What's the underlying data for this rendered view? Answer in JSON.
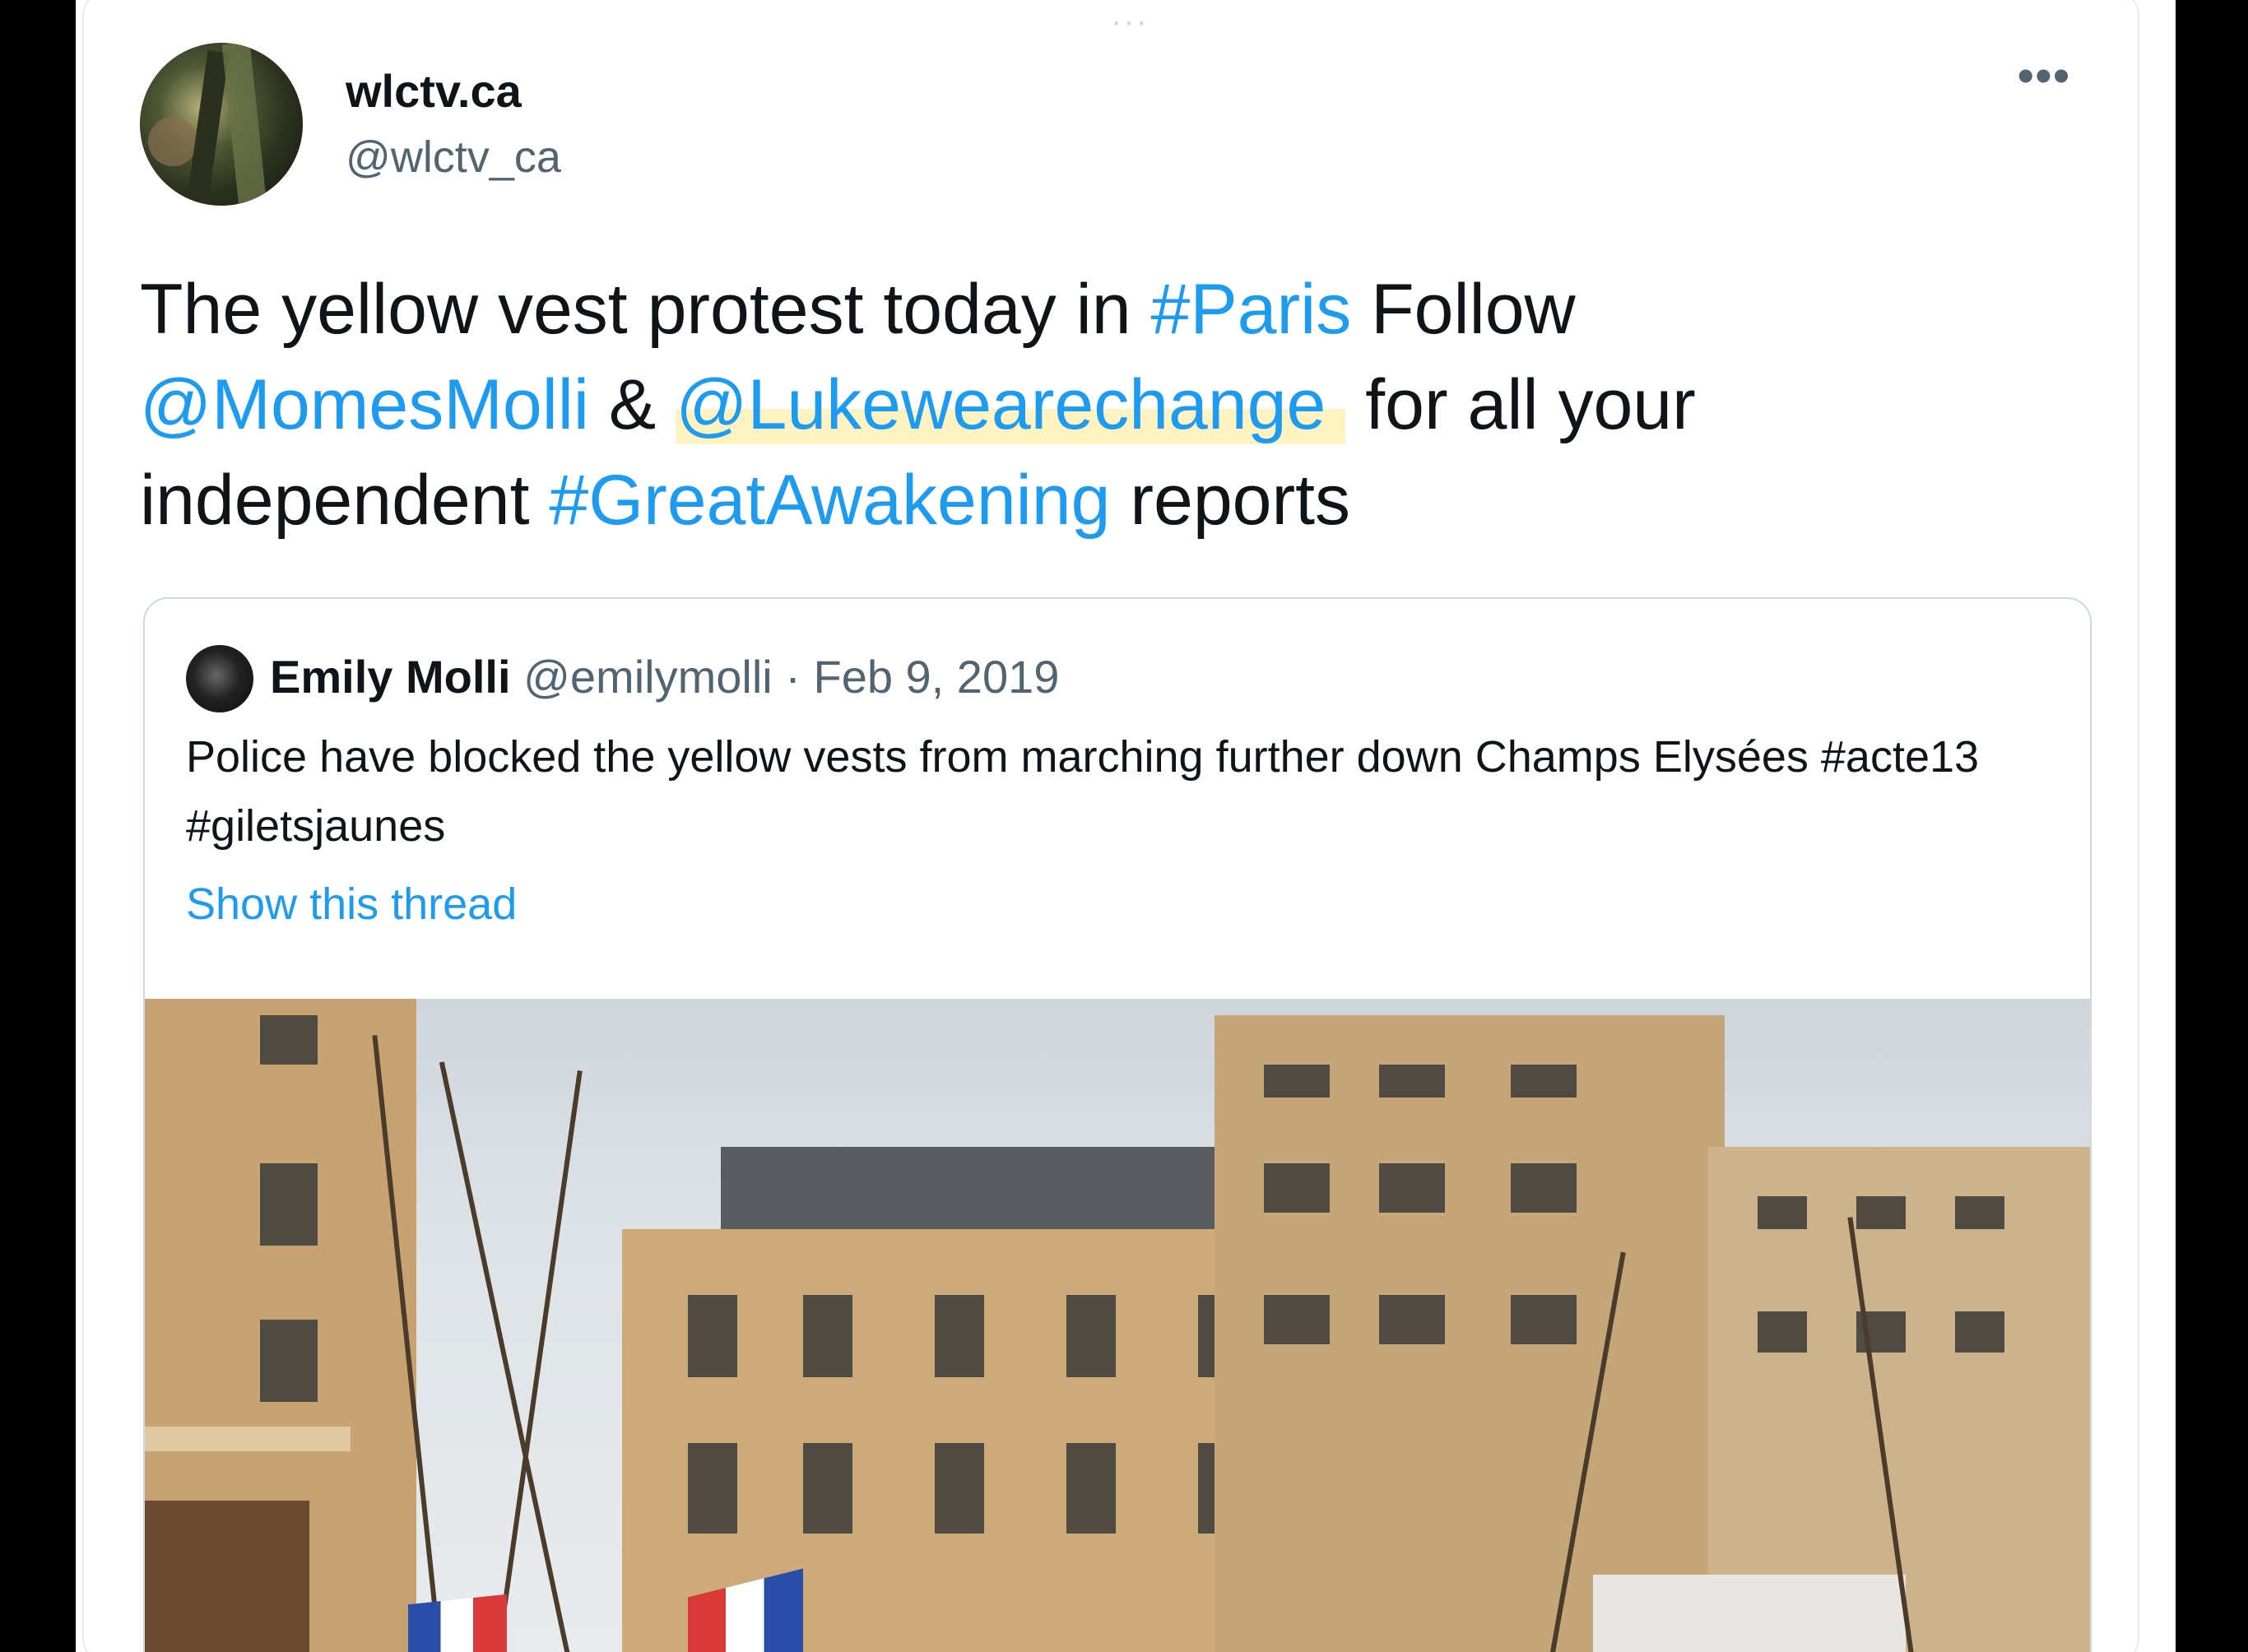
{
  "tweet": {
    "author": {
      "name": "wlctv.ca",
      "handle": "@wlctv_ca"
    },
    "more_label": "•••",
    "text_parts": {
      "p1": "The yellow vest protest today in ",
      "tag_paris": "#Paris",
      "p2": " Follow ",
      "mention1": "@MomesMolli",
      "p3": " & ",
      "mention2": "@Lukewearechange",
      "p4": " for all your independent ",
      "tag_awakening": "#GreatAwakening",
      "p5": " reports"
    }
  },
  "quoted_tweet": {
    "name": "Emily Molli",
    "handle": "@emilymolli",
    "separator": "·",
    "date": "Feb 9, 2019",
    "text": "Police have blocked the yellow vests from marching further down Champs Elysées #acte13 #giletsjaunes",
    "show_thread": "Show this thread"
  },
  "colors": {
    "link": "#1d9bf0",
    "text": "#0f1419",
    "secondary": "#536471",
    "highlight": "#ffeca0"
  }
}
